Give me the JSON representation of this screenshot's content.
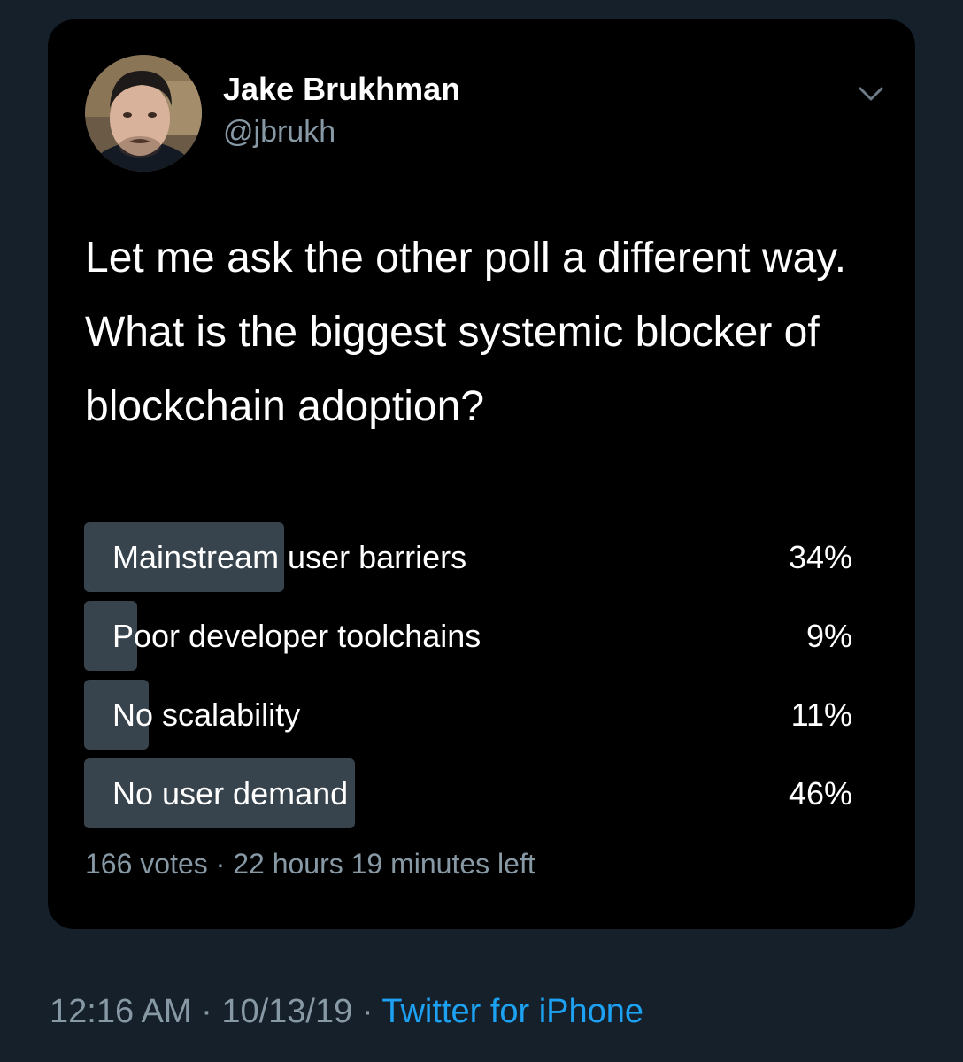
{
  "author": {
    "display_name": "Jake Brukhman",
    "handle": "@jbrukh"
  },
  "icons": {
    "menu": "chevron-down-icon",
    "avatar": "user-avatar-photo"
  },
  "tweet": {
    "text": "Let me ask the other poll a different way. What is the biggest systemic blocker of blockchain adoption?"
  },
  "poll": {
    "options": [
      {
        "label": "Mainstream user barriers",
        "percent_label": "34%",
        "percent": 34
      },
      {
        "label": "Poor developer toolchains",
        "percent_label": "9%",
        "percent": 9
      },
      {
        "label": "No scalability",
        "percent_label": "11%",
        "percent": 11
      },
      {
        "label": "No user demand",
        "percent_label": "46%",
        "percent": 46
      }
    ],
    "votes": "166 votes",
    "separator": " · ",
    "time_left": "22 hours 19 minutes left"
  },
  "footer": {
    "time": "12:16 AM",
    "date": "10/13/19",
    "separator": " · ",
    "source": "Twitter for iPhone"
  },
  "colors": {
    "page_bg": "#15202b",
    "card_bg": "#000000",
    "poll_bar": "#38444d",
    "secondary_text": "#8899a6",
    "link": "#1da1f2"
  }
}
